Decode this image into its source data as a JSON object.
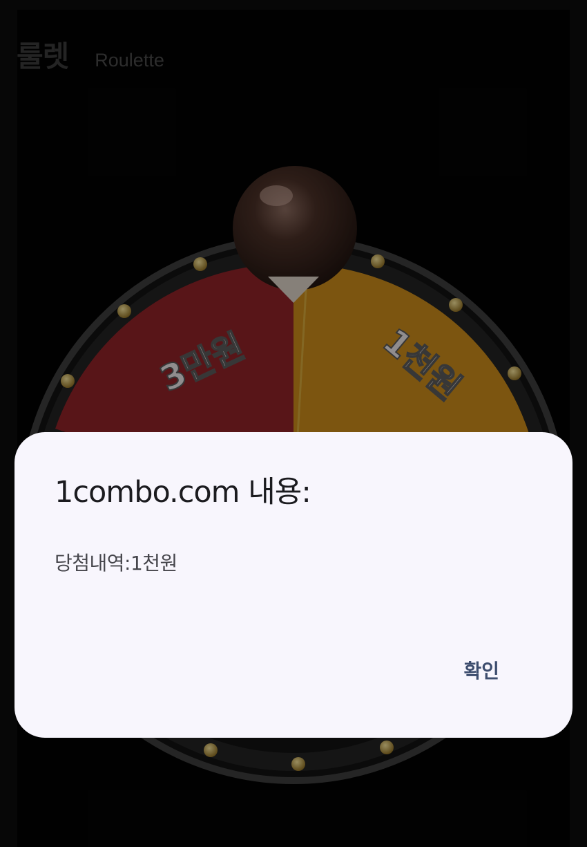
{
  "header": {
    "title_ko": "룰렛",
    "title_en": "Roulette"
  },
  "wheel": {
    "segments": [
      {
        "label": "3만원",
        "color": "#8f2228"
      },
      {
        "label": "1천원",
        "color": "#c98a1b"
      },
      {
        "label": "",
        "color": "#1f6f8b"
      }
    ]
  },
  "dialog": {
    "title": "1combo.com 내용:",
    "message": "당첨내역:1천원",
    "ok_label": "확인"
  }
}
